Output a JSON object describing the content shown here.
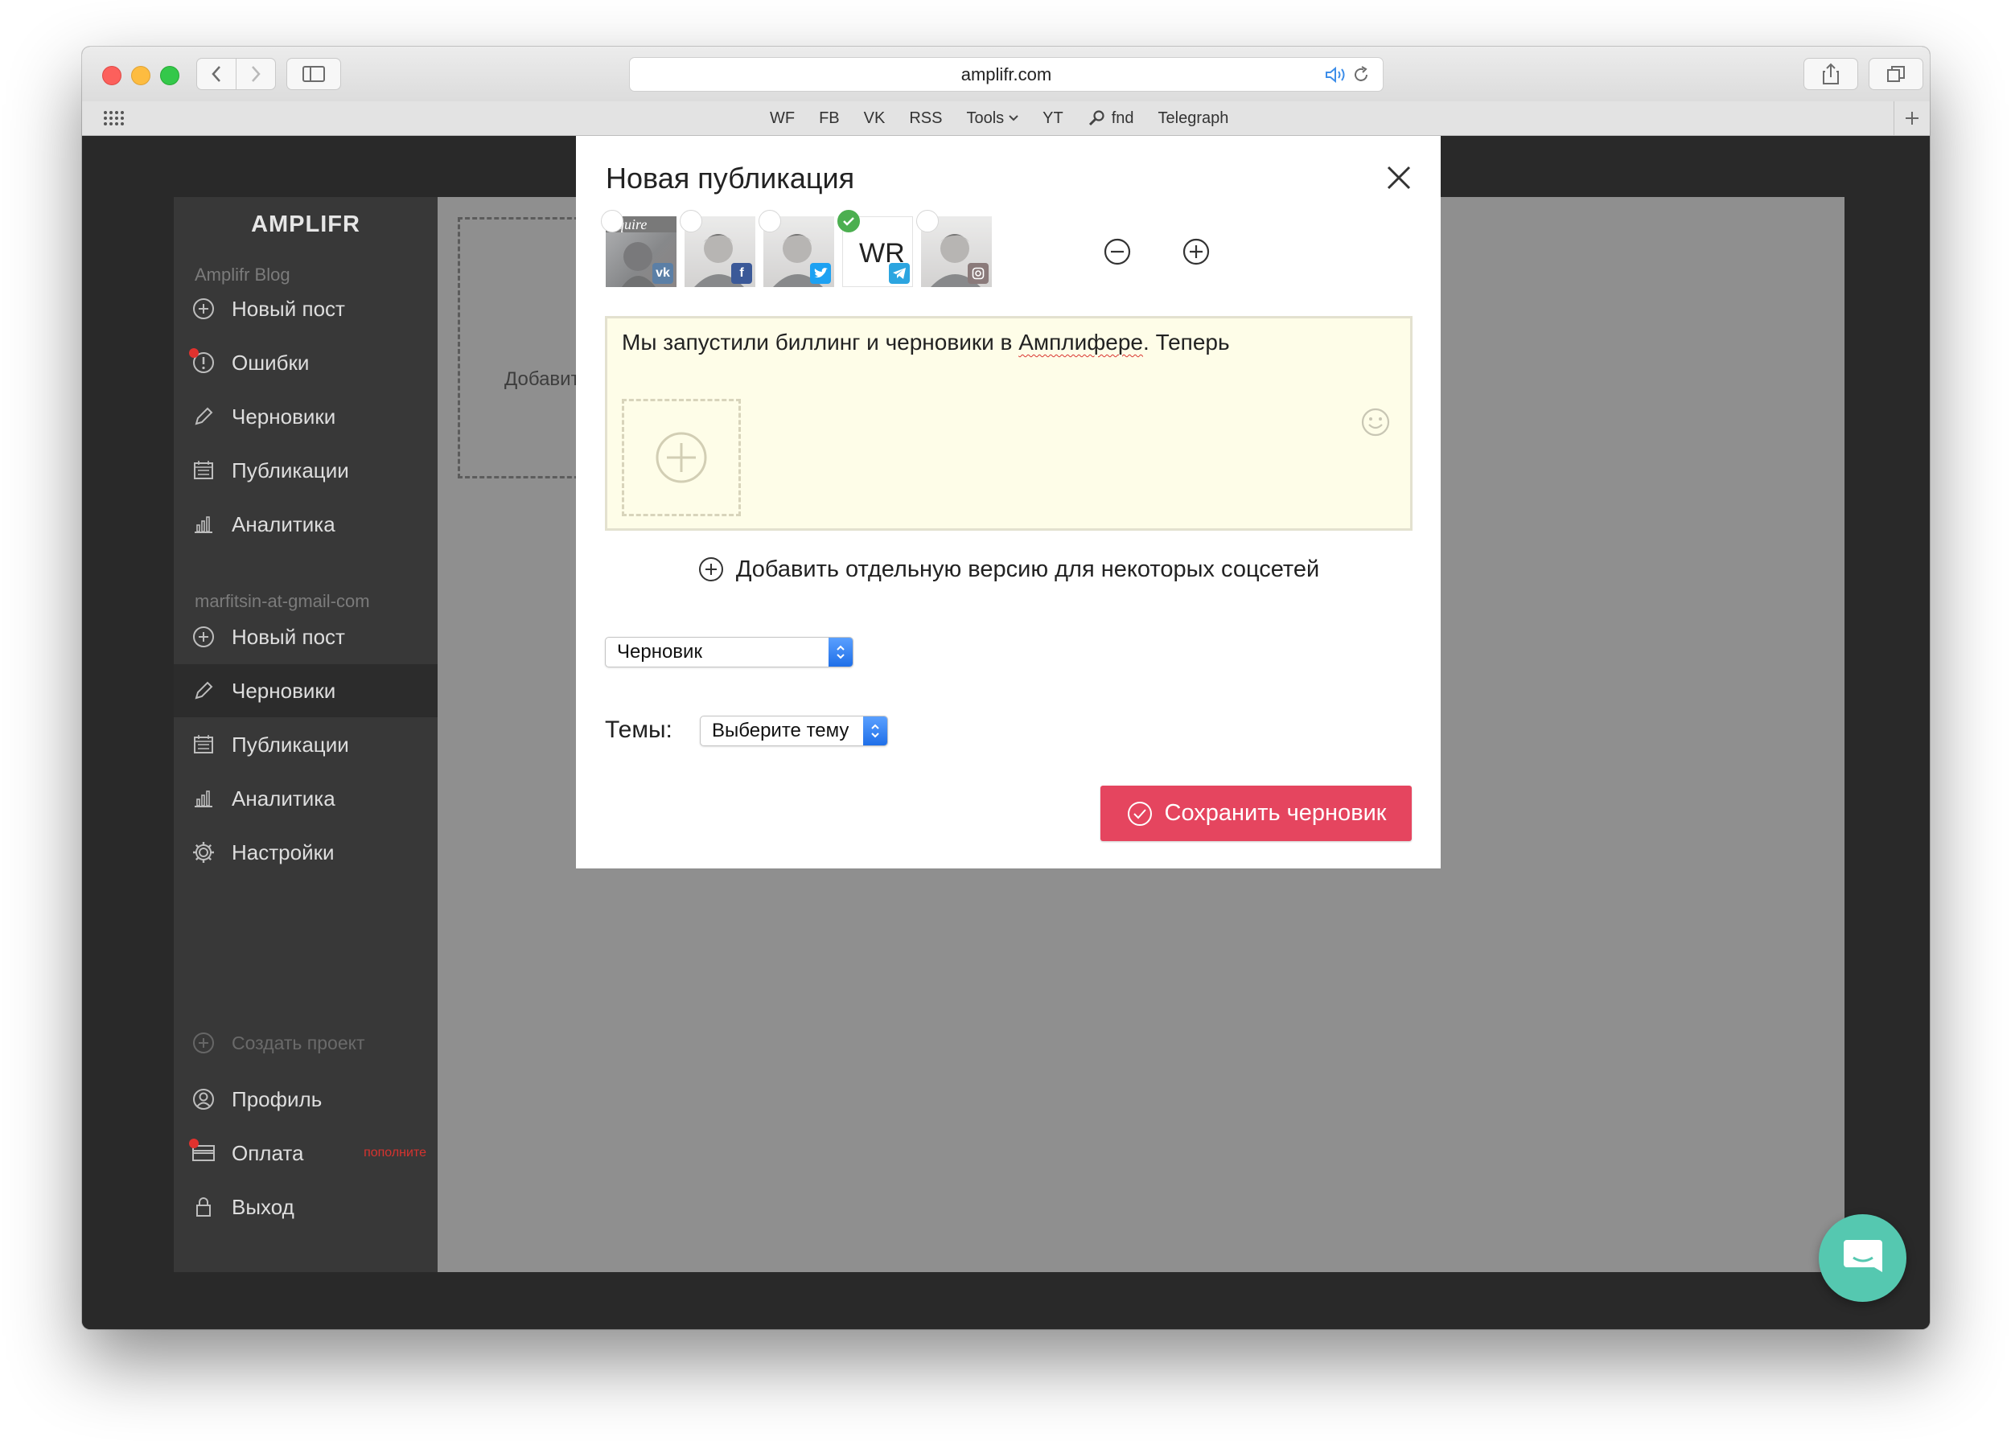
{
  "browser": {
    "url": "amplifr.com",
    "bookmarks": [
      "WF",
      "FB",
      "VK",
      "RSS",
      "Tools",
      "YT",
      "fnd",
      "Telegraph"
    ]
  },
  "sidebar": {
    "logo": "AMPLIFR",
    "projects": [
      {
        "label": "Amplifr Blog",
        "items": [
          {
            "label": "Новый пост",
            "icon": "plus-circle-icon"
          },
          {
            "label": "Ошибки",
            "icon": "alert-icon"
          },
          {
            "label": "Черновики",
            "icon": "pencil-icon"
          },
          {
            "label": "Публикации",
            "icon": "calendar-icon"
          },
          {
            "label": "Аналитика",
            "icon": "bar-chart-icon"
          }
        ]
      },
      {
        "label": "marfitsin-at-gmail-com",
        "items": [
          {
            "label": "Новый пост",
            "icon": "plus-circle-icon"
          },
          {
            "label": "Черновики",
            "icon": "pencil-icon"
          },
          {
            "label": "Публикации",
            "icon": "calendar-icon"
          },
          {
            "label": "Аналитика",
            "icon": "bar-chart-icon"
          },
          {
            "label": "Настройки",
            "icon": "gear-icon"
          }
        ]
      }
    ],
    "create_project": "Создать проект",
    "profile": "Профиль",
    "payment": "Оплата",
    "payment_note": "пополните",
    "logout": "Выход"
  },
  "background": {
    "drop_text": "Добавит"
  },
  "modal": {
    "title": "Новая публикация",
    "accounts": [
      {
        "network": "vk",
        "selected": false,
        "avatar_text": "quire"
      },
      {
        "network": "facebook",
        "selected": false
      },
      {
        "network": "twitter",
        "selected": false
      },
      {
        "network": "telegram",
        "selected": true,
        "avatar_text": "WR"
      },
      {
        "network": "instagram",
        "selected": false
      }
    ],
    "editor": {
      "text_before": "Мы запустили биллинг и черновики в ",
      "text_misspelled": "Амплифере",
      "text_after": ". Теперь"
    },
    "add_version": "Добавить отдельную версию для некоторых соцсетей",
    "status_select": "Черновик",
    "topics_label": "Темы:",
    "topics_select": "Выберите тему",
    "save_button": "Сохранить черновик"
  },
  "colors": {
    "accent_save": "#e5455f",
    "check_green": "#4caf50",
    "chat_teal": "#55c8b0",
    "sidebar_bg": "#383838",
    "editor_bg": "#fefde8"
  }
}
